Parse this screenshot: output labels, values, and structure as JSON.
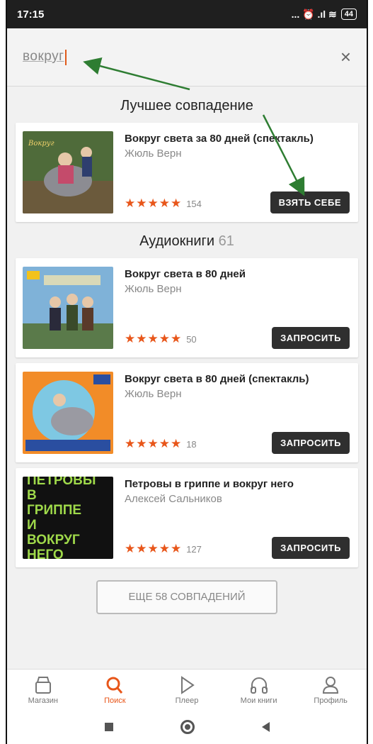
{
  "status": {
    "time": "17:15",
    "battery": "44",
    "icons": "... ⏰ .ıl ≋"
  },
  "search": {
    "query": "вокруг",
    "close_glyph": "×"
  },
  "best_match": {
    "heading": "Лучшее совпадение",
    "book": {
      "title": "Вокруг света за 80 дней (спектакль)",
      "author": "Жюль Верн",
      "stars": "★★★★★",
      "rating": 4.5,
      "count": "154",
      "button": "ВЗЯТЬ СЕБЕ"
    }
  },
  "audiobooks": {
    "heading": "Аудиокниги",
    "count": "61",
    "items": [
      {
        "title": "Вокруг света в 80 дней",
        "author": "Жюль Верн",
        "stars": "★★★★★",
        "count": "50",
        "button": "ЗАПРОСИТЬ"
      },
      {
        "title": "Вокруг света в 80 дней (спектакль)",
        "author": "Жюль Верн",
        "stars": "★★★★★",
        "count": "18",
        "button": "ЗАПРОСИТЬ"
      },
      {
        "title": "Петровы в гриппе и вокруг него",
        "author": "Алексей Сальников",
        "stars": "★★★★★",
        "rating": 4.5,
        "count": "127",
        "button": "ЗАПРОСИТЬ",
        "cover_text": "ПЕТРОВЫ В ГРИППЕ И ВОКРУГ НЕГО"
      }
    ]
  },
  "more_button": "ЕЩЕ 58 СОВПАДЕНИЙ",
  "tabs": [
    {
      "label": "Магазин",
      "icon": "store-icon"
    },
    {
      "label": "Поиск",
      "icon": "search-icon",
      "active": true
    },
    {
      "label": "Плеер",
      "icon": "play-icon"
    },
    {
      "label": "Мои книги",
      "icon": "headphones-icon"
    },
    {
      "label": "Профиль",
      "icon": "profile-icon"
    }
  ],
  "colors": {
    "accent": "#e8561a",
    "button_dark": "#2f2f2f",
    "annotation_arrow": "#2e7d32"
  }
}
